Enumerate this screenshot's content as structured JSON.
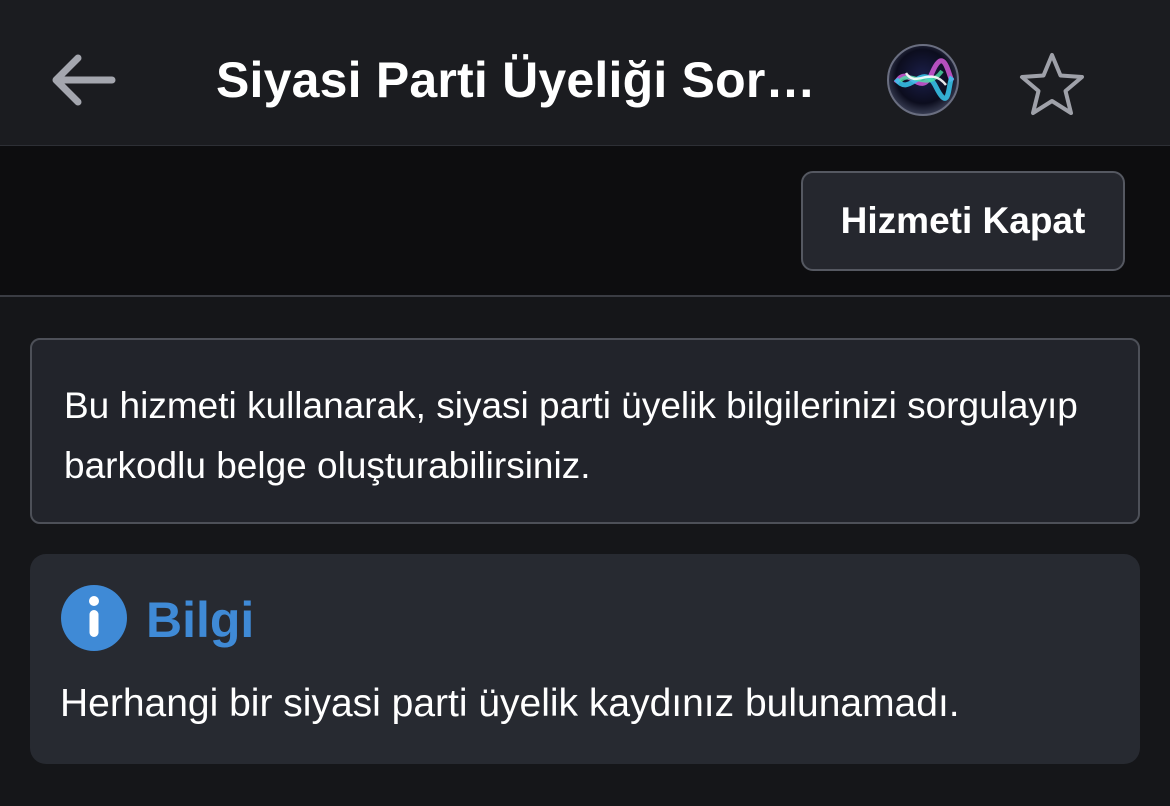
{
  "header": {
    "title": "Siyasi Parti Üyeliği Sor…",
    "back_icon": "back-arrow-icon",
    "assistant_icon": "siri-icon",
    "favorite_icon": "star-outline-icon"
  },
  "toolbar": {
    "close_service_label": "Hizmeti Kapat"
  },
  "description": {
    "text": "Bu hizmeti kullanarak, siyasi parti üyelik bilgilerinizi sorgulayıp barkodlu belge oluşturabilirsiniz."
  },
  "info": {
    "icon": "info-circle-icon",
    "title": "Bilgi",
    "message": "Herhangi bir siyasi parti üyelik kaydınız bulunamadı."
  },
  "colors": {
    "accent": "#3f8ad6",
    "background": "#151619",
    "card": "#272a31"
  }
}
